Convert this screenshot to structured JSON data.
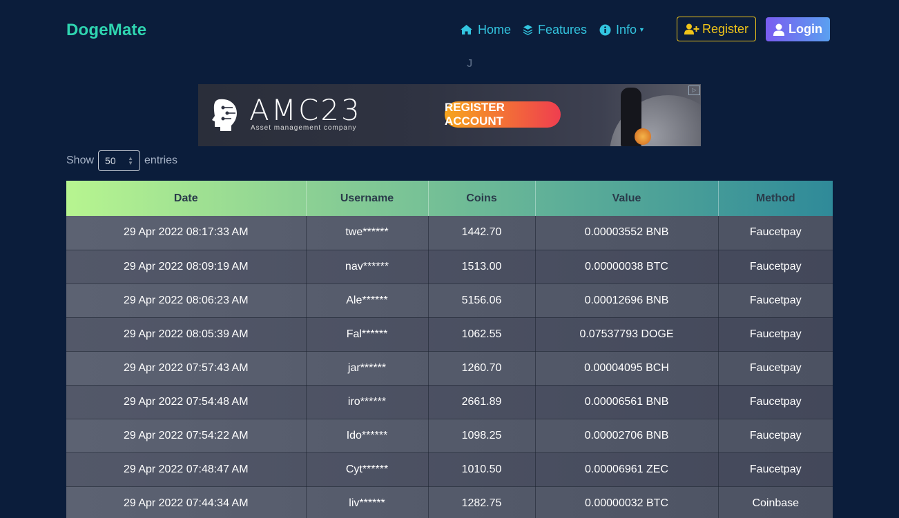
{
  "brand": "DogeMate",
  "nav": {
    "home": "Home",
    "features": "Features",
    "info": "Info",
    "register": "Register",
    "login": "Login"
  },
  "banner": {
    "brand": "AMC23",
    "tagline": "Asset management company",
    "cta": "REGISTER ACCOUNT"
  },
  "entries": {
    "show_label": "Show",
    "value": "50",
    "suffix_label": "entries"
  },
  "table": {
    "headers": [
      "Date",
      "Username",
      "Coins",
      "Value",
      "Method"
    ],
    "rows": [
      [
        "29 Apr 2022 08:17:33 AM",
        "twe******",
        "1442.70",
        "0.00003552 BNB",
        "Faucetpay"
      ],
      [
        "29 Apr 2022 08:09:19 AM",
        "nav******",
        "1513.00",
        "0.00000038 BTC",
        "Faucetpay"
      ],
      [
        "29 Apr 2022 08:06:23 AM",
        "Ale******",
        "5156.06",
        "0.00012696 BNB",
        "Faucetpay"
      ],
      [
        "29 Apr 2022 08:05:39 AM",
        "Fal******",
        "1062.55",
        "0.07537793 DOGE",
        "Faucetpay"
      ],
      [
        "29 Apr 2022 07:57:43 AM",
        "jar******",
        "1260.70",
        "0.00004095 BCH",
        "Faucetpay"
      ],
      [
        "29 Apr 2022 07:54:48 AM",
        "iro******",
        "2661.89",
        "0.00006561 BNB",
        "Faucetpay"
      ],
      [
        "29 Apr 2022 07:54:22 AM",
        "Ido******",
        "1098.25",
        "0.00002706 BNB",
        "Faucetpay"
      ],
      [
        "29 Apr 2022 07:48:47 AM",
        "Cyt******",
        "1010.50",
        "0.00006961 ZEC",
        "Faucetpay"
      ],
      [
        "29 Apr 2022 07:44:34 AM",
        "liv******",
        "1282.75",
        "0.00000032 BTC",
        "Coinbase"
      ]
    ]
  },
  "colors": {
    "background": "#0b1d3b",
    "brand": "#2fd5b0",
    "nav_link": "#33c5e0",
    "register_accent": "#f0c419"
  },
  "icons": {
    "home": "home-icon",
    "features": "layers-icon",
    "info": "info-circle-icon",
    "register": "user-plus-icon",
    "login": "user-icon"
  }
}
